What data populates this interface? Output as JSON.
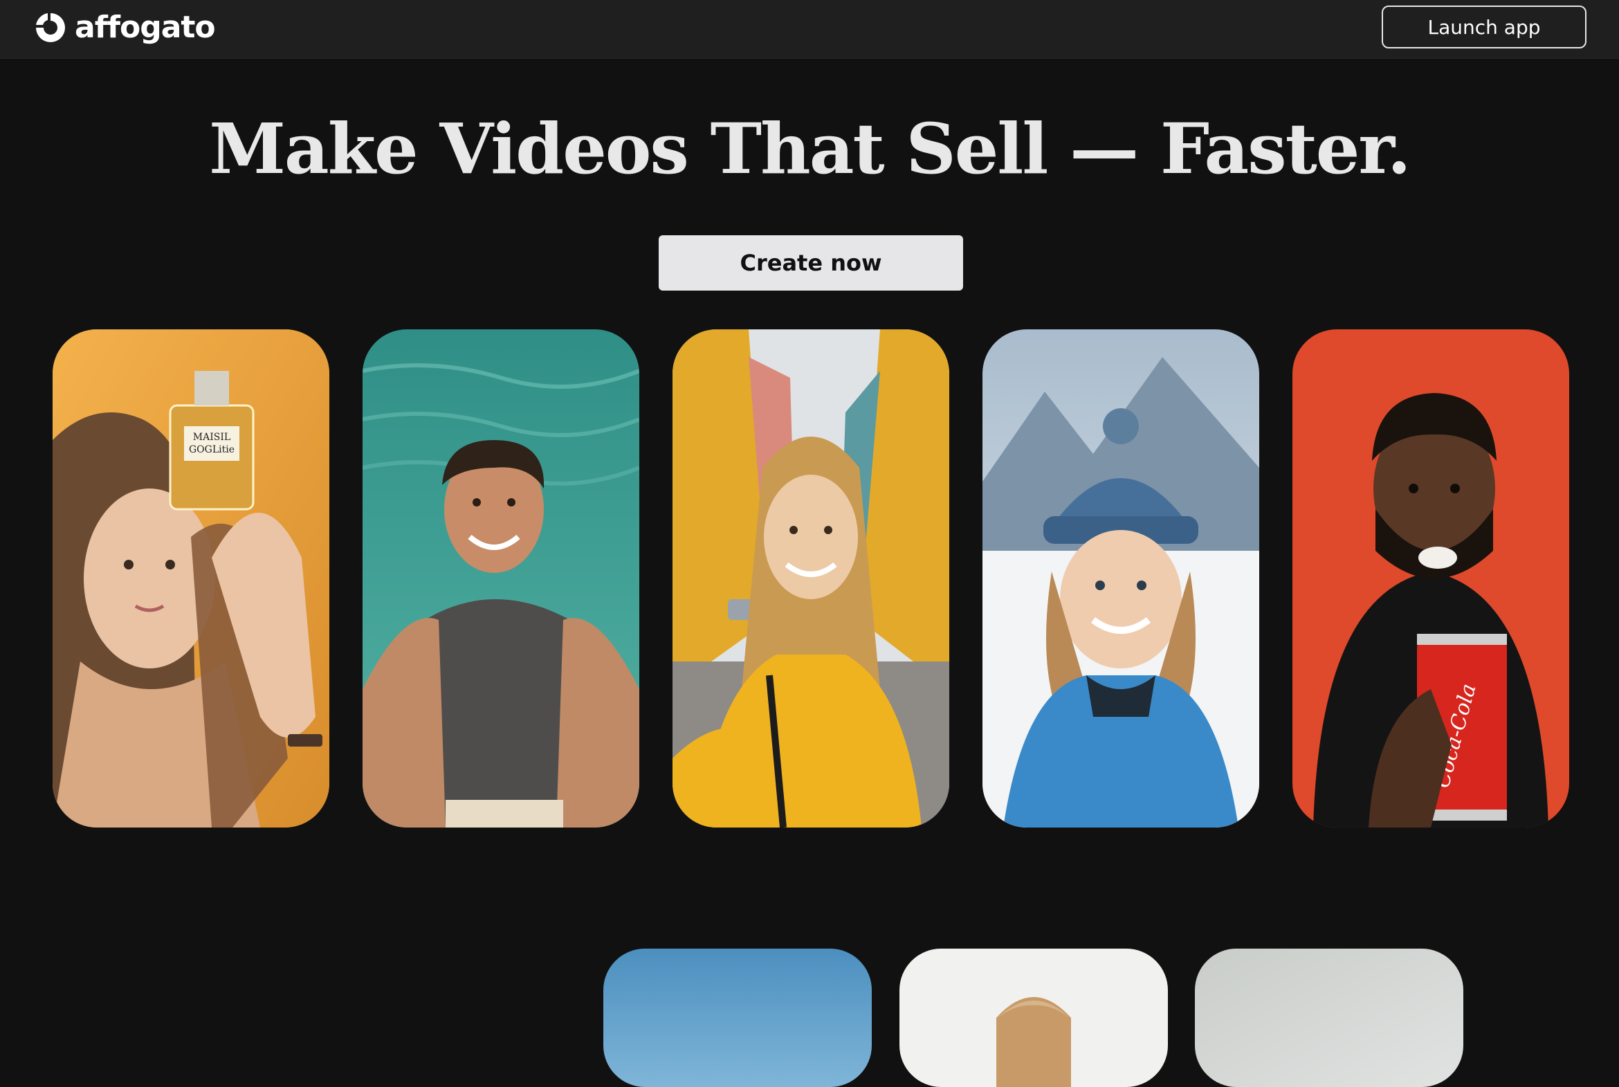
{
  "header": {
    "brand_name": "affogato",
    "launch_label": "Launch app"
  },
  "hero": {
    "title": "Make Videos That Sell — Faster.",
    "cta_label": "Create now"
  },
  "cards": [
    {
      "subject": "woman holding perfume bottle",
      "product_label_line1": "MAISIL",
      "product_label_line2": "GOGLitie",
      "accent": "#f0a63a"
    },
    {
      "subject": "man taking selfie above sea water",
      "accent": "#3f9e94"
    },
    {
      "subject": "woman in yellow jacket on city street",
      "accent": "#e8b325"
    },
    {
      "subject": "woman in knit hat in snowy mountains",
      "accent": "#3d7dbf"
    },
    {
      "subject": "man holding soda can",
      "product_label": "Coca-Cola",
      "accent": "#e0452a"
    }
  ],
  "cards_row2": [
    {
      "subject": "sky scene",
      "accent": "#5b9bc8"
    },
    {
      "subject": "man portrait on light background",
      "accent": "#f2f2f0"
    },
    {
      "subject": "light gray scene",
      "accent": "#d4d8d6"
    }
  ]
}
